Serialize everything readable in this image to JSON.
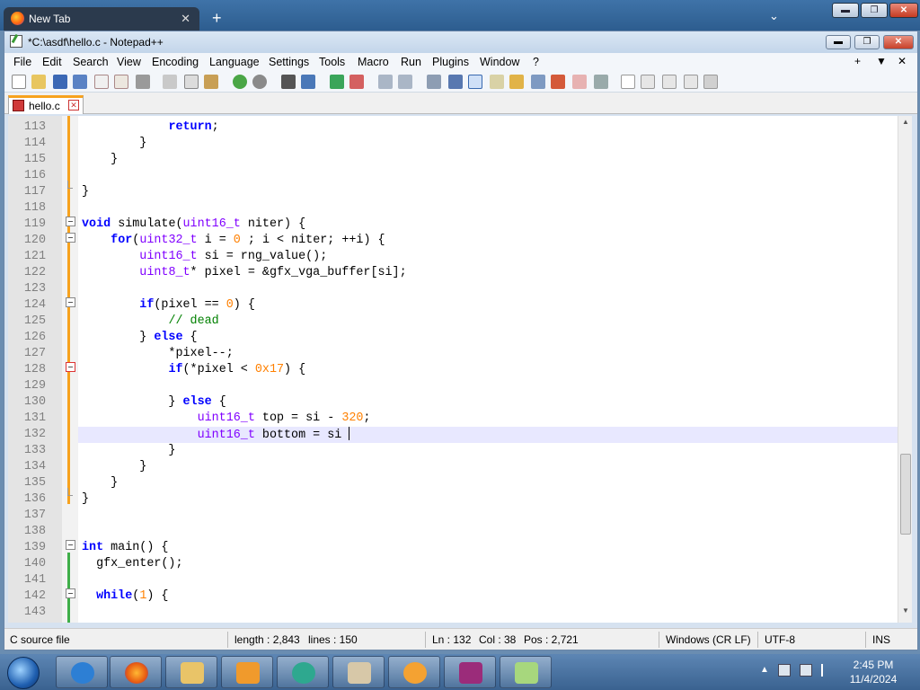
{
  "browser": {
    "tab_title": "New Tab",
    "new_tab": "+",
    "tab_list": "⌄",
    "btn_minimize": "▬",
    "btn_restore": "❐",
    "btn_close": "✕"
  },
  "window": {
    "title": "*C:\\asdf\\hello.c - Notepad++",
    "btn_minimize": "▬",
    "btn_restore": "❐",
    "btn_close": "✕"
  },
  "menu": {
    "items": [
      "File",
      "Edit",
      "Search",
      "View",
      "Encoding",
      "Language",
      "Settings",
      "Tools",
      "Macro",
      "Run",
      "Plugins",
      "Window",
      "?"
    ],
    "right": [
      "+",
      "▼",
      "✕"
    ]
  },
  "toolbar": {
    "icons": [
      "new-file-icon",
      "open-file-icon",
      "save-icon",
      "save-all-icon",
      "close-icon",
      "close-all-icon",
      "print-icon",
      "cut-icon",
      "copy-icon",
      "paste-icon",
      "undo-icon",
      "redo-icon",
      "find-icon",
      "replace-icon",
      "zoom-in-icon",
      "zoom-out-icon",
      "sync-v-icon",
      "sync-h-icon",
      "word-wrap-icon",
      "show-all-chars-icon",
      "indent-guide-icon",
      "udl-icon",
      "doc-map-icon",
      "func-list-icon",
      "folder-workspace-icon",
      "monitor-icon",
      "record-macro-icon",
      "stop-macro-icon",
      "play-macro-icon",
      "run-macro-multiple-icon",
      "save-macro-icon"
    ]
  },
  "document_tab": {
    "name": "hello.c",
    "close": "✕"
  },
  "editor": {
    "current_line": 132,
    "lines": [
      {
        "n": "113",
        "code": "            return;"
      },
      {
        "n": "114",
        "code": "        }"
      },
      {
        "n": "115",
        "code": "    }"
      },
      {
        "n": "116",
        "code": ""
      },
      {
        "n": "117",
        "code": "}"
      },
      {
        "n": "118",
        "code": ""
      },
      {
        "n": "119",
        "code": "void simulate(uint16_t niter) {"
      },
      {
        "n": "120",
        "code": "    for(uint32_t i = 0 ; i < niter; ++i) {"
      },
      {
        "n": "121",
        "code": "        uint16_t si = rng_value();"
      },
      {
        "n": "122",
        "code": "        uint8_t* pixel = &gfx_vga_buffer[si];"
      },
      {
        "n": "123",
        "code": ""
      },
      {
        "n": "124",
        "code": "        if(pixel == 0) {"
      },
      {
        "n": "125",
        "code": "            // dead"
      },
      {
        "n": "126",
        "code": "        } else {"
      },
      {
        "n": "127",
        "code": "            *pixel--;"
      },
      {
        "n": "128",
        "code": "            if(*pixel < 0x17) {"
      },
      {
        "n": "129",
        "code": ""
      },
      {
        "n": "130",
        "code": "            } else {"
      },
      {
        "n": "131",
        "code": "                uint16_t top = si - 320;"
      },
      {
        "n": "132",
        "code": "                uint16_t bottom = si "
      },
      {
        "n": "133",
        "code": "            }"
      },
      {
        "n": "134",
        "code": "        }"
      },
      {
        "n": "135",
        "code": "    }"
      },
      {
        "n": "136",
        "code": "}"
      },
      {
        "n": "137",
        "code": ""
      },
      {
        "n": "138",
        "code": ""
      },
      {
        "n": "139",
        "code": "int main() {"
      },
      {
        "n": "140",
        "code": "  gfx_enter();"
      },
      {
        "n": "141",
        "code": ""
      },
      {
        "n": "142",
        "code": "  while(1) {"
      },
      {
        "n": "143",
        "code": ""
      }
    ]
  },
  "status": {
    "file_type": "C source file",
    "length": "length : 2,843",
    "lines": "lines : 150",
    "ln": "Ln : 132",
    "col": "Col : 38",
    "pos": "Pos : 2,721",
    "eol": "Windows (CR LF)",
    "encoding": "UTF-8",
    "mode": "INS"
  },
  "taskbar": {
    "apps": [
      "internet-explorer-icon",
      "firefox-icon",
      "file-explorer-icon",
      "media-player-icon",
      "app-bubble-icon",
      "paint-icon",
      "scratch-icon",
      "winrar-icon",
      "notepadpp-icon"
    ],
    "time": "2:45 PM",
    "date": "11/4/2024"
  },
  "colors": {
    "keyword": "#0000ff",
    "type": "#8000ff",
    "number": "#ff8000",
    "comment": "#008000",
    "current_line_bg": "#e8e8ff",
    "fold_marker_changed": "#f7a21e",
    "fold_marker_saved": "#3fae49"
  }
}
